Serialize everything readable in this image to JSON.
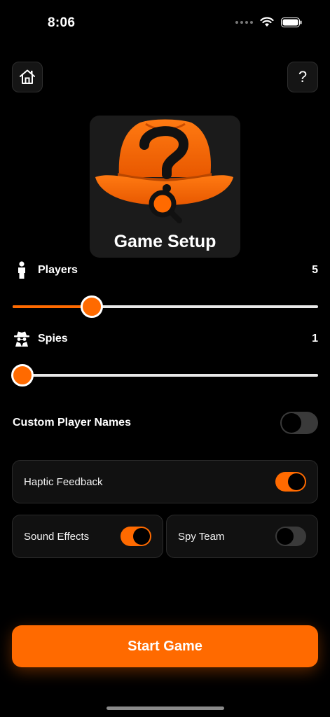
{
  "status_bar": {
    "time": "8:06"
  },
  "header": {
    "help_label": "?"
  },
  "hero": {
    "title": "Game Setup"
  },
  "players": {
    "label": "Players",
    "value": "5",
    "slider_fraction": 0.243
  },
  "spies": {
    "label": "Spies",
    "value": "1",
    "slider_fraction": 0.0
  },
  "custom_names": {
    "label": "Custom Player Names",
    "enabled": false
  },
  "settings": {
    "haptic": {
      "label": "Haptic Feedback",
      "enabled": true
    },
    "sound": {
      "label": "Sound Effects",
      "enabled": true
    },
    "spy_team": {
      "label": "Spy Team",
      "enabled": false
    }
  },
  "start_button": {
    "label": "Start Game"
  },
  "colors": {
    "accent": "#ff6a00",
    "background": "#000000",
    "card": "#111111"
  }
}
